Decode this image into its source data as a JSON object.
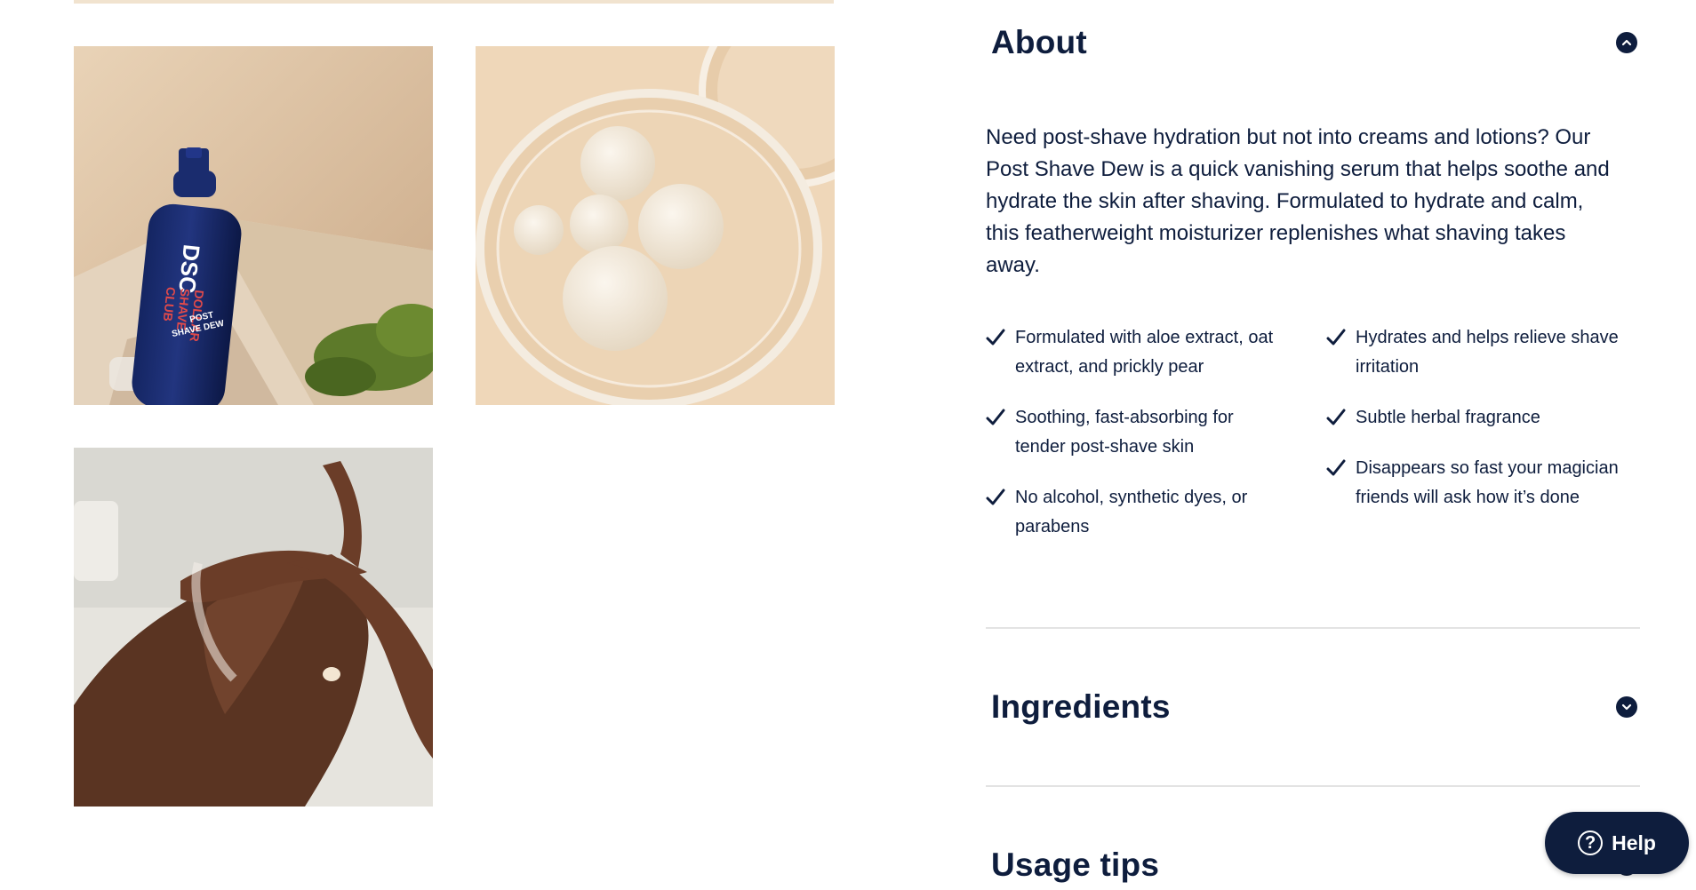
{
  "gallery": {
    "images": [
      {
        "name": "post-shave-dew-bottle-image",
        "bottle_text": [
          "DSC",
          "DOLLAR",
          "SHAVE",
          "CLUB",
          "POST",
          "SHAVE DEW"
        ]
      },
      {
        "name": "serum-dish-image"
      },
      {
        "name": "knee-application-image"
      }
    ]
  },
  "about": {
    "title": "About",
    "expanded": true,
    "description": "Need post-shave hydration but not into creams and lotions? Our Post Shave Dew is a quick vanishing serum that helps soothe and hydrate the skin after shaving. Formulated to hydrate and calm, this featherweight moisturizer replenishes what shaving takes away.",
    "benefits_left": [
      "Formulated with aloe extract, oat extract, and prickly pear",
      "Soothing, fast-absorbing for tender post-shave skin",
      "No alcohol, synthetic dyes, or parabens"
    ],
    "benefits_right": [
      "Hydrates and helps relieve shave irritation",
      "Subtle herbal fragrance",
      "Disappears so fast your magician friends will ask how it’s done"
    ]
  },
  "ingredients": {
    "title": "Ingredients",
    "expanded": false
  },
  "usage": {
    "title": "Usage tips",
    "expanded": false
  },
  "help": {
    "label": "Help",
    "icon": "question-circle-icon"
  },
  "colors": {
    "navy": "#0e1d3d",
    "divider": "#e3e3e3",
    "accent_red": "#e04a4a"
  }
}
